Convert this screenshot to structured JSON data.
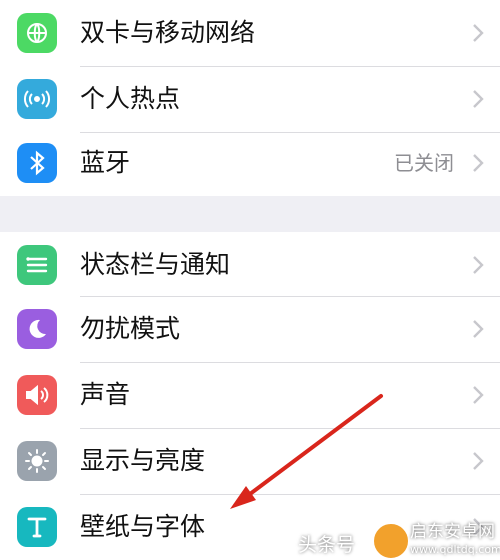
{
  "settings": {
    "group1": [
      {
        "label": "双卡与移动网络",
        "icon": "globe-icon",
        "color": "#4cd964"
      },
      {
        "label": "个人热点",
        "icon": "hotspot-icon",
        "color": "#34aadc"
      },
      {
        "label": "蓝牙",
        "icon": "bluetooth-icon",
        "color": "#1e8ef5",
        "value": "已关闭"
      }
    ],
    "group2": [
      {
        "label": "状态栏与通知",
        "icon": "notification-icon",
        "color": "#3ec77c"
      },
      {
        "label": "勿扰模式",
        "icon": "moon-icon",
        "color": "#9a5ee0"
      },
      {
        "label": "声音",
        "icon": "speaker-icon",
        "color": "#f05a5a"
      },
      {
        "label": "显示与亮度",
        "icon": "brightness-icon",
        "color": "#9aa3ad"
      },
      {
        "label": "壁纸与字体",
        "icon": "text-icon",
        "color": "#17b8bf"
      }
    ]
  },
  "watermark": {
    "source": "头条号",
    "site_name": "启东安卓网",
    "site_url": "www.qdltdq.com"
  }
}
